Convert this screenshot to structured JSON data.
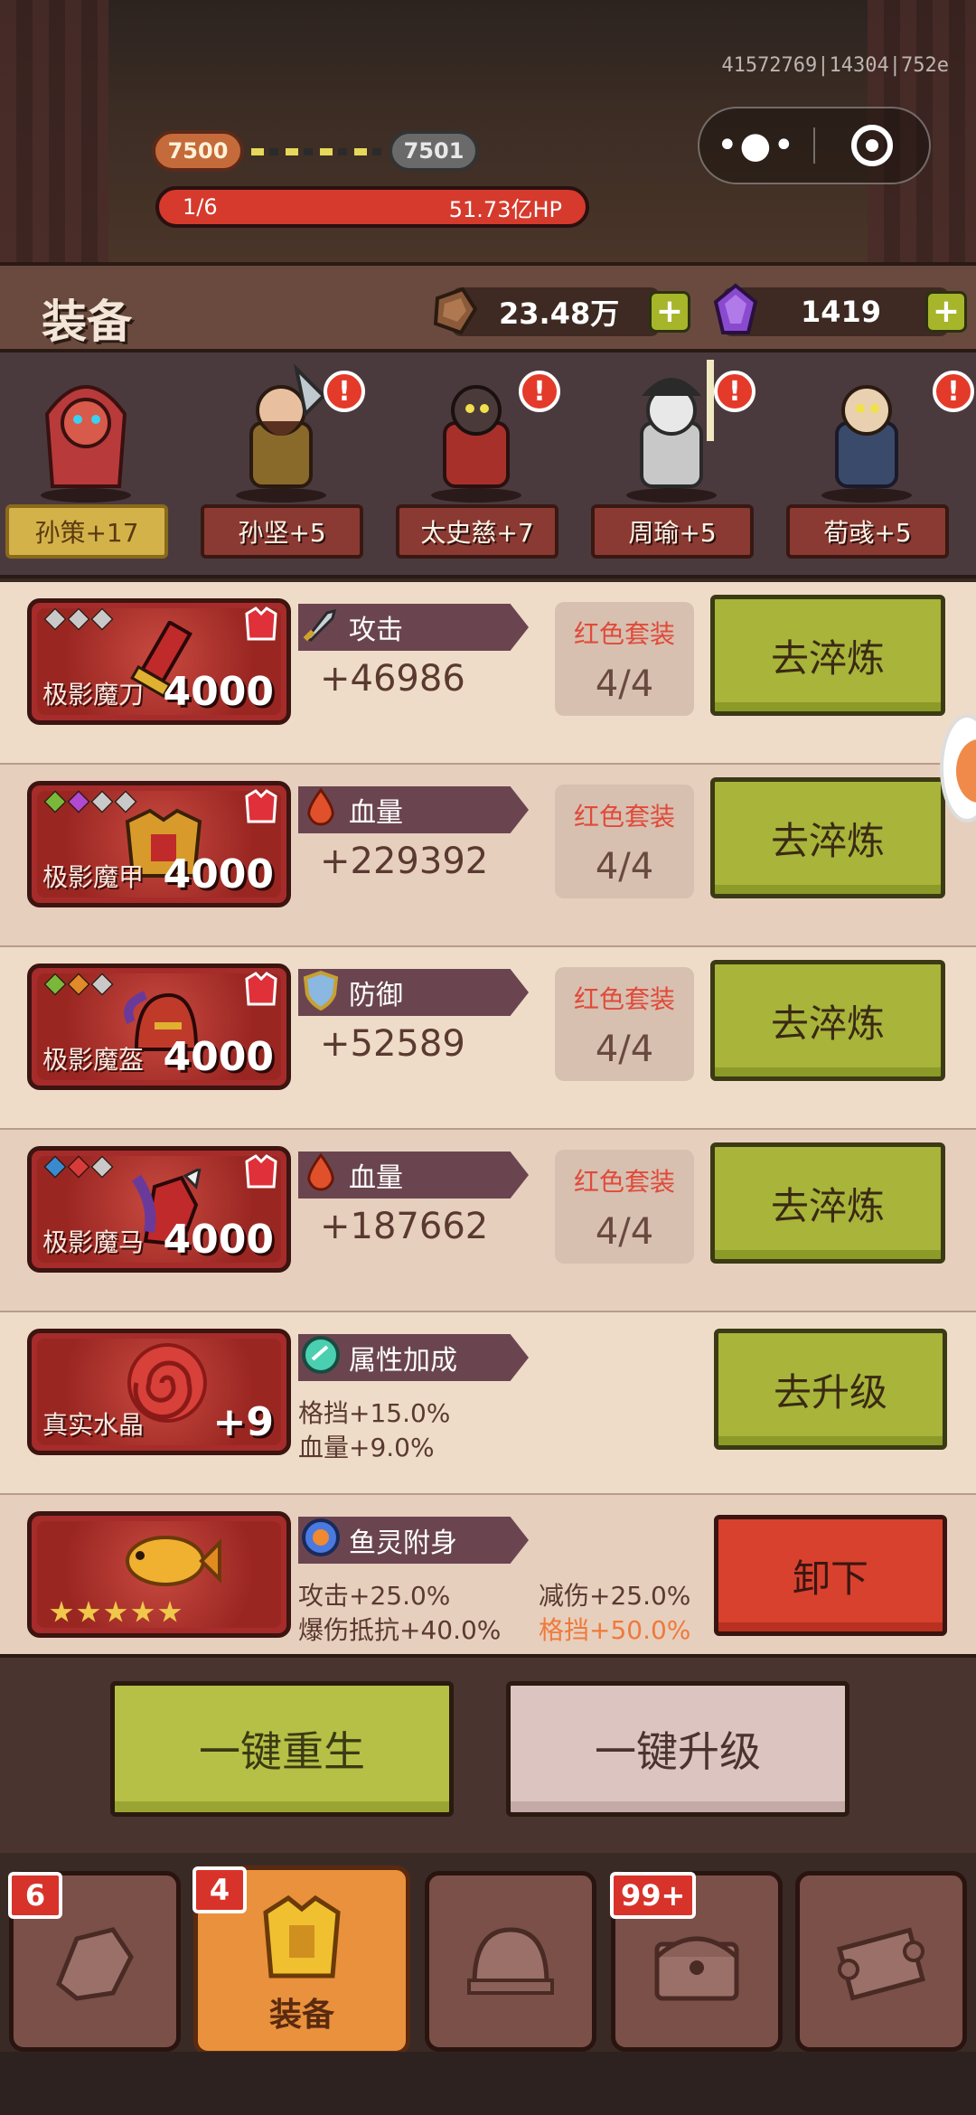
{
  "session_code": "41572769|14304|752e",
  "stage": {
    "current": "7500",
    "next": "7501",
    "progress": "1/6",
    "hp": "51.73亿HP"
  },
  "header": {
    "title": "装备",
    "resource1": "23.48万",
    "resource2": "1419",
    "plus": "+"
  },
  "heroes": [
    {
      "name": "孙策+17",
      "selected": true,
      "alert": false
    },
    {
      "name": "孙坚+5",
      "selected": false,
      "alert": true
    },
    {
      "name": "太史慈+7",
      "selected": false,
      "alert": true
    },
    {
      "name": "周瑜+5",
      "selected": false,
      "alert": true
    },
    {
      "name": "荀彧+5",
      "selected": false,
      "alert": true
    }
  ],
  "alert_mark": "!",
  "equipment": [
    {
      "name": "极影魔刀",
      "level": "4000",
      "stat": "攻击",
      "value": "+46986",
      "set_label": "红色套装",
      "set_count": "4/4",
      "action": "去淬炼",
      "gems": [
        "#c9c9c9",
        "#c9c9c9",
        "#c9c9c9"
      ]
    },
    {
      "name": "极影魔甲",
      "level": "4000",
      "stat": "血量",
      "value": "+229392",
      "set_label": "红色套装",
      "set_count": "4/4",
      "action": "去淬炼",
      "gems": [
        "#7ab83a",
        "#b04ad0",
        "#c9c9c9",
        "#c9c9c9"
      ]
    },
    {
      "name": "极影魔盔",
      "level": "4000",
      "stat": "防御",
      "value": "+52589",
      "set_label": "红色套装",
      "set_count": "4/4",
      "action": "去淬炼",
      "gems": [
        "#7ab83a",
        "#e08a2a",
        "#c9c9c9"
      ]
    },
    {
      "name": "极影魔马",
      "level": "4000",
      "stat": "血量",
      "value": "+187662",
      "set_label": "红色套装",
      "set_count": "4/4",
      "action": "去淬炼",
      "gems": [
        "#3a8ad0",
        "#d83a3a",
        "#c9c9c9"
      ]
    }
  ],
  "crystal": {
    "name": "真实水晶",
    "level": "+9",
    "stat": "属性加成",
    "line1": "格挡+15.0%",
    "line2": "血量+9.0%",
    "action": "去升级"
  },
  "fish": {
    "stat": "鱼灵附身",
    "line1": "攻击+25.0%",
    "line2": "爆伤抵抗+40.0%",
    "line3": "减伤+25.0%",
    "line4": "格挡+50.0%",
    "action": "卸下",
    "stars": 5
  },
  "bottom": {
    "rebirth": "一键重生",
    "upgrade": "一键升级"
  },
  "nav": [
    {
      "badge": "6",
      "label": "",
      "active": false
    },
    {
      "badge": "4",
      "label": "装备",
      "active": true
    },
    {
      "badge": "",
      "label": "",
      "active": false
    },
    {
      "badge": "99+",
      "label": "",
      "active": false
    },
    {
      "badge": "",
      "label": "",
      "active": false
    }
  ]
}
